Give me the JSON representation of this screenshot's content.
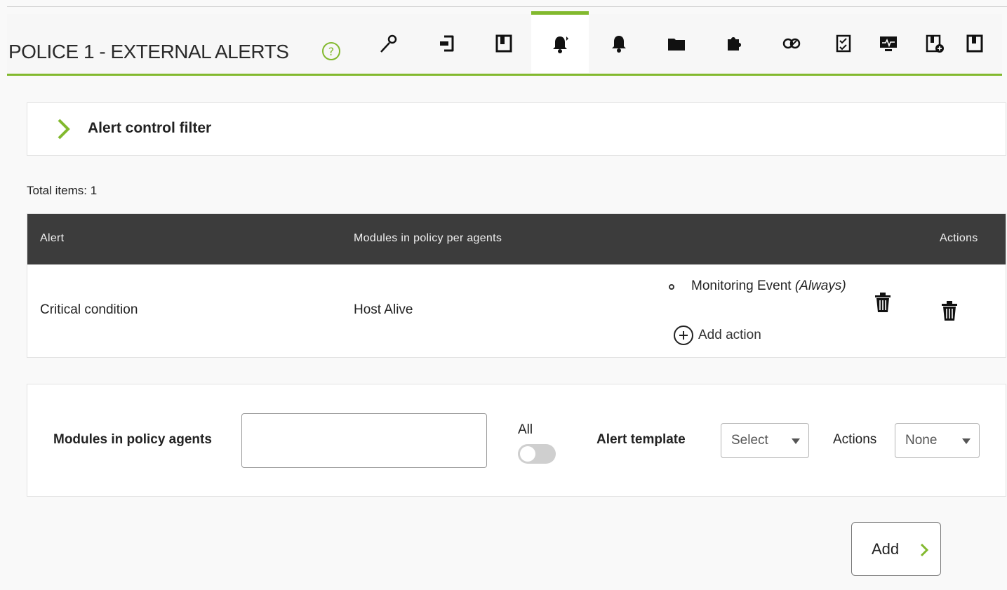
{
  "header": {
    "title": "POLICE 1 - EXTERNAL ALERTS",
    "tabs": [
      {
        "icon": "wrench-icon"
      },
      {
        "icon": "sign-in-icon"
      },
      {
        "icon": "modules-icon"
      },
      {
        "icon": "external-alerts-icon",
        "active": true
      },
      {
        "icon": "alerts-icon"
      },
      {
        "icon": "folder-icon"
      },
      {
        "icon": "plugin-icon"
      },
      {
        "icon": "inventory-link-icon"
      },
      {
        "icon": "checklist-icon"
      },
      {
        "icon": "monitor-icon"
      },
      {
        "icon": "add-module-icon"
      },
      {
        "icon": "collection-icon"
      }
    ]
  },
  "filter": {
    "label": "Alert control filter"
  },
  "total_items": "Total items: 1",
  "table": {
    "headers": {
      "alert": "Alert",
      "modules": "Modules in policy per agents",
      "actions": "Actions"
    },
    "rows": [
      {
        "alert": "Critical condition",
        "module": "Host Alive",
        "action_name": "Monitoring Event",
        "action_mode": "(Always)",
        "add_action": "Add action"
      }
    ]
  },
  "form": {
    "modules_label": "Modules in policy agents",
    "modules_value": "",
    "all_label": "All",
    "all_enabled": false,
    "template_label": "Alert template",
    "template_value": "Select",
    "actions_label": "Actions",
    "actions_value": "None"
  },
  "add_button": "Add",
  "colors": {
    "accent": "#82b92e",
    "table_header": "#3c3c3c"
  }
}
